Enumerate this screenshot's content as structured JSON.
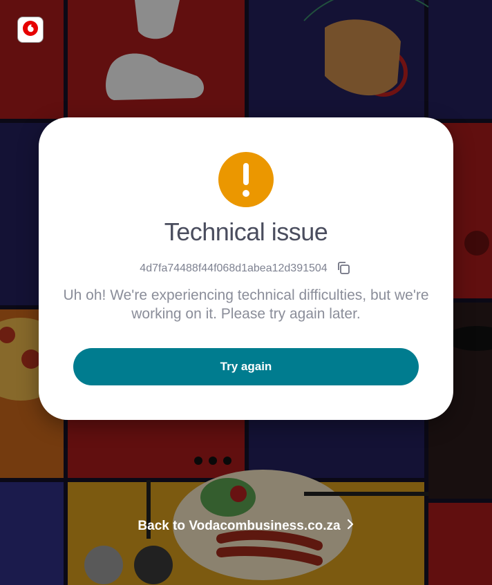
{
  "brand": {
    "logo_icon": "vodafone-speechmark-icon",
    "logo_color": "#e60000"
  },
  "error_card": {
    "icon": "exclamation-icon",
    "icon_color": "#eb9700",
    "title": "Technical issue",
    "error_id": "4d7fa74488f44f068d1abea12d391504",
    "copy_icon": "copy-icon",
    "message": "Uh oh! We're experiencing technical difficulties, but we're working on it. Please try again later.",
    "retry_label": "Try again",
    "accent_color": "#007c8f"
  },
  "footer": {
    "back_link_label": "Back to Vodacombusiness.co.za",
    "back_link_icon": "chevron-right-icon"
  }
}
